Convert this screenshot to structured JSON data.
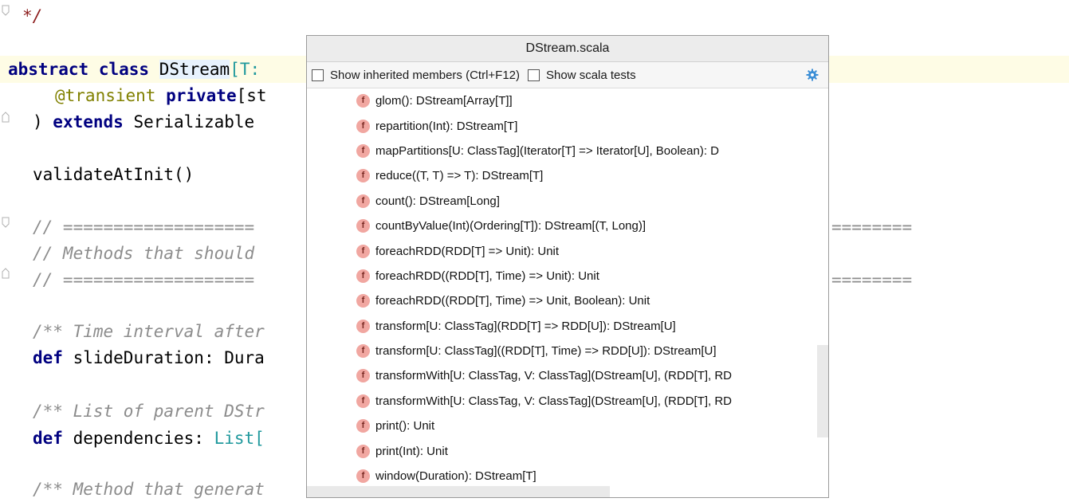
{
  "editor": {
    "lines": {
      "l0": "*/",
      "l1_abstract": "abstract",
      "l1_class": "class",
      "l1_name": "DStream",
      "l1_rest": "[T:",
      "l2_anno": "@transient",
      "l2_private": "private",
      "l2_rest": "[st",
      "l3_paren": ") ",
      "l3_extends": "extends",
      "l3_rest": " Serializable",
      "l4": "validateAtInit()",
      "l5": "// ===================",
      "l5_right": "========",
      "l6": "// Methods that should",
      "l7": "// ===================",
      "l7_right": "========",
      "l8": "/** Time interval after",
      "l9_def": "def",
      "l9_rest": " slideDuration: Dura",
      "l10": "/** List of parent DStr",
      "l11_def": "def",
      "l11_rest": " dependencies: ",
      "l11_type": "List[",
      "l12": "/** Method that generat"
    }
  },
  "popup": {
    "title": "DStream.scala",
    "show_inherited_label": "Show inherited members (Ctrl+F12)",
    "show_scala_tests_label": "Show scala tests",
    "member_icon_letter": "f",
    "members": [
      "glom(): DStream[Array[T]]",
      "repartition(Int): DStream[T]",
      "mapPartitions[U: ClassTag](Iterator[T] => Iterator[U], Boolean): D",
      "reduce((T, T) => T): DStream[T]",
      "count(): DStream[Long]",
      "countByValue(Int)(Ordering[T]): DStream[(T, Long)]",
      "foreachRDD(RDD[T] => Unit): Unit",
      "foreachRDD((RDD[T], Time) => Unit): Unit",
      "foreachRDD((RDD[T], Time) => Unit, Boolean): Unit",
      "transform[U: ClassTag](RDD[T] => RDD[U]): DStream[U]",
      "transform[U: ClassTag]((RDD[T], Time) => RDD[U]): DStream[U]",
      "transformWith[U: ClassTag, V: ClassTag](DStream[U], (RDD[T], RD",
      "transformWith[U: ClassTag, V: ClassTag](DStream[U], (RDD[T], RD",
      "print(): Unit",
      "print(Int): Unit",
      "window(Duration): DStream[T]"
    ]
  },
  "colors": {
    "keyword": "#000080",
    "comment": "#8c8c8c",
    "annotation": "#808000",
    "type_param": "#20999d",
    "member_icon_bg": "#f1a7a1",
    "current_line": "#fefce5"
  }
}
